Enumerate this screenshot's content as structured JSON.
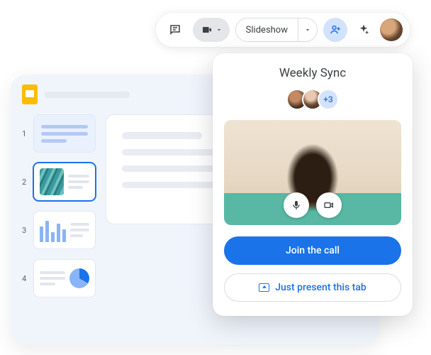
{
  "toolbar": {
    "slideshow_label": "Slideshow"
  },
  "call": {
    "title": "Weekly Sync",
    "more_participants": "+3",
    "join_label": "Join the call",
    "present_label": "Just present this tab"
  },
  "slides": {
    "thumbs": [
      {
        "num": "1"
      },
      {
        "num": "2"
      },
      {
        "num": "3"
      },
      {
        "num": "4"
      }
    ]
  }
}
